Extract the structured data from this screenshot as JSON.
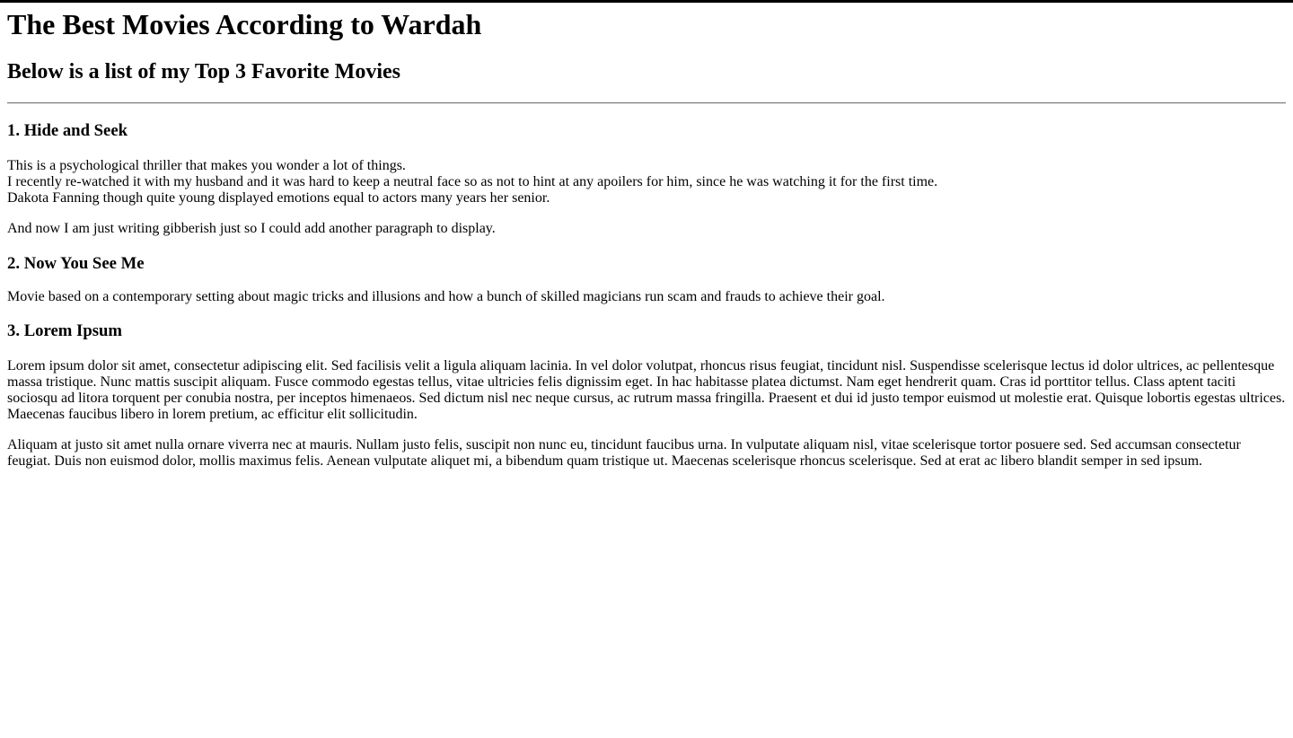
{
  "page": {
    "title": "The Best Movies According to Wardah",
    "subtitle": "Below is a list of my Top 3 Favorite Movies"
  },
  "movies": [
    {
      "heading": "1. Hide and Seek",
      "paragraphs": [
        [
          "This is a psychological thriller that makes you wonder a lot of things.",
          "I recently re-watched it with my husband and it was hard to keep a neutral face so as not to hint at any apoilers for him, since he was watching it for the first time.",
          "Dakota Fanning though quite young displayed emotions equal to actors many years her senior."
        ],
        [
          "And now I am just writing gibberish just so I could add another paragraph to display."
        ]
      ]
    },
    {
      "heading": "2. Now You See Me",
      "paragraphs": [
        [
          "Movie based on a contemporary setting about magic tricks and illusions and how a bunch of skilled magicians run scam and frauds to achieve their goal."
        ]
      ]
    },
    {
      "heading": "3. Lorem Ipsum",
      "paragraphs": [
        [
          "Lorem ipsum dolor sit amet, consectetur adipiscing elit. Sed facilisis velit a ligula aliquam lacinia. In vel dolor volutpat, rhoncus risus feugiat, tincidunt nisl. Suspendisse scelerisque lectus id dolor ultrices, ac pellentesque massa tristique. Nunc mattis suscipit aliquam. Fusce commodo egestas tellus, vitae ultricies felis dignissim eget. In hac habitasse platea dictumst. Nam eget hendrerit quam. Cras id porttitor tellus. Class aptent taciti sociosqu ad litora torquent per conubia nostra, per inceptos himenaeos. Sed dictum nisl nec neque cursus, ac rutrum massa fringilla. Praesent et dui id justo tempor euismod ut molestie erat. Quisque lobortis egestas ultrices. Maecenas faucibus libero in lorem pretium, ac efficitur elit sollicitudin."
        ],
        [
          "Aliquam at justo sit amet nulla ornare viverra nec at mauris. Nullam justo felis, suscipit non nunc eu, tincidunt faucibus urna. In vulputate aliquam nisl, vitae scelerisque tortor posuere sed. Sed accumsan consectetur feugiat. Duis non euismod dolor, mollis maximus felis. Aenean vulputate aliquet mi, a bibendum quam tristique ut. Maecenas scelerisque rhoncus scelerisque. Sed at erat ac libero blandit semper in sed ipsum."
        ]
      ]
    }
  ]
}
